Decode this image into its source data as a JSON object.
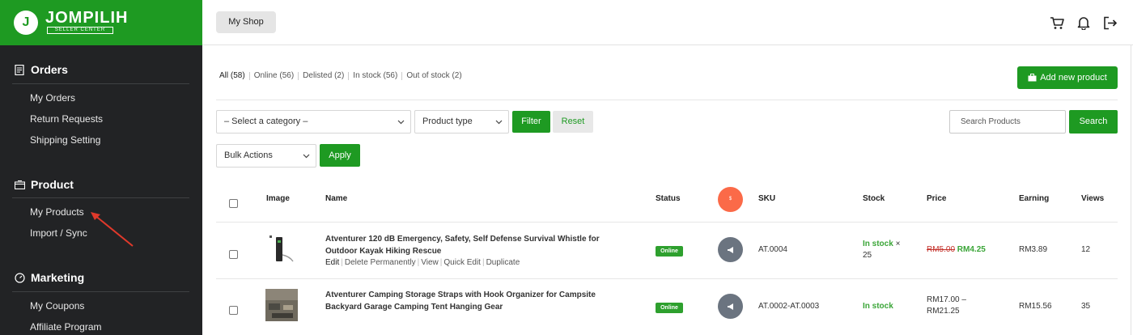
{
  "brand": {
    "mark": "J",
    "name": "JOMPILIH",
    "subtitle": "SELLER CENTER"
  },
  "sidebar": {
    "sections": [
      {
        "title": "Orders",
        "icon": "receipt-icon",
        "items": [
          "My Orders",
          "Return Requests",
          "Shipping Setting"
        ]
      },
      {
        "title": "Product",
        "icon": "box-icon",
        "items": [
          "My Products",
          "Import / Sync"
        ]
      },
      {
        "title": "Marketing",
        "icon": "gauge-icon",
        "items": [
          "My Coupons",
          "Affiliate Program"
        ]
      }
    ]
  },
  "header": {
    "shop_button": "My Shop",
    "icons": [
      "cart-icon",
      "bell-icon",
      "logout-icon"
    ]
  },
  "filters": {
    "status_tabs": [
      "All (58)",
      "Online (56)",
      "Delisted (2)",
      "In stock (56)",
      "Out of stock (2)"
    ],
    "add_button": "Add new product",
    "category_select": "– Select a category –",
    "type_select": "Product type",
    "filter_button": "Filter",
    "reset_button": "Reset",
    "search_placeholder": "Search Products",
    "search_button": "Search",
    "bulk_select": "Bulk Actions",
    "apply_button": "Apply"
  },
  "table": {
    "columns": {
      "image": "Image",
      "name": "Name",
      "status": "Status",
      "promo_badge": "$",
      "sku": "SKU",
      "stock": "Stock",
      "price": "Price",
      "earning": "Earning",
      "views": "Views"
    },
    "rows": [
      {
        "name_line1": "Atventurer 120 dB Emergency, Safety, Self Defense Survival Whistle for",
        "name_line2": "Outdoor Kayak Hiking Rescue",
        "actions": [
          "Edit",
          "Delete Permanently",
          "View",
          "Quick Edit",
          "Duplicate"
        ],
        "status": "Online",
        "sku": "AT.0004",
        "stock_status": "In stock",
        "stock_qty": "× 25",
        "price_old": "RM5.00",
        "price_new": "RM4.25",
        "earning": "RM3.89",
        "views": "12"
      },
      {
        "name_line1": "Atventurer Camping Storage Straps with Hook Organizer for Campsite",
        "name_line2": "Backyard Garage Camping Tent Hanging Gear",
        "status": "Online",
        "sku": "AT.0002-AT.0003",
        "stock_status": "In stock",
        "price_range_line1": "RM17.00 –",
        "price_range_line2": "RM21.25",
        "earning": "RM15.56",
        "views": "35"
      }
    ]
  },
  "colors": {
    "brand_green": "#1e9a22",
    "sidebar_bg": "#222325",
    "stock_green": "#3aa537",
    "strike_red": "#c4312a",
    "promo_orange": "#fb6a48",
    "arrow_red": "#e0392b"
  }
}
